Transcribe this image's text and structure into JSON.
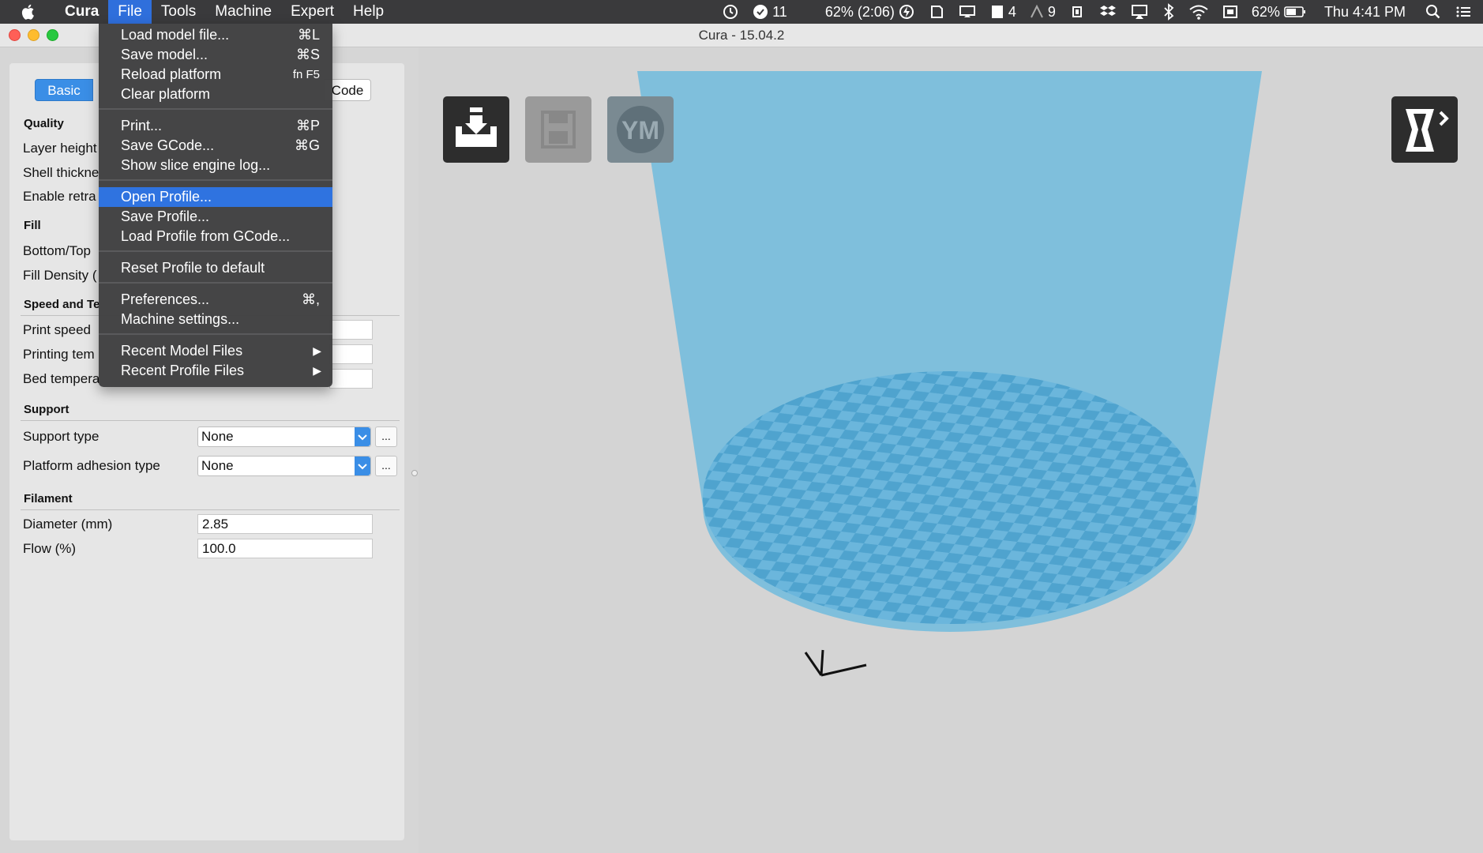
{
  "menubar": {
    "app_name": "Cura",
    "items": [
      "File",
      "Tools",
      "Machine",
      "Expert",
      "Help"
    ],
    "active_item": "File"
  },
  "status": {
    "notification_count": "11",
    "battery_estimate": "62% (2:06)",
    "badge_a": "4",
    "badge_b": "9",
    "battery_percent": "62%",
    "clock": "Thu 4:41 PM"
  },
  "window": {
    "title": "Cura - 15.04.2",
    "traffic_lights": {
      "close": "#ff5f57",
      "minimize": "#febc2e",
      "zoom": "#28c840"
    }
  },
  "panel": {
    "tabs": {
      "basic": "Basic",
      "gcode_partial": "Code"
    },
    "sections": {
      "quality": "Quality",
      "fill": "Fill",
      "speed": "Speed and Te",
      "support": "Support",
      "filament": "Filament"
    },
    "labels": {
      "layer_height": "Layer height",
      "shell_thickness": "Shell thickne",
      "enable_retraction": "Enable retra",
      "bottom_top": "Bottom/Top",
      "fill_density": "Fill Density (",
      "print_speed": "Print speed",
      "printing_temp": "Printing tem",
      "bed_temp": "Bed tempera",
      "support_type": "Support type",
      "platform_adhesion": "Platform adhesion type",
      "diameter": "Diameter (mm)",
      "flow": "Flow (%)"
    },
    "values": {
      "support_type": "None",
      "platform_adhesion": "None",
      "diameter": "2.85",
      "flow": "100.0",
      "ellipsis": "..."
    }
  },
  "file_menu": {
    "load_model": {
      "label": "Load model file...",
      "shortcut": "⌘L"
    },
    "save_model": {
      "label": "Save model...",
      "shortcut": "⌘S"
    },
    "reload_platform": {
      "label": "Reload platform",
      "shortcut": "fn F5"
    },
    "clear_platform": {
      "label": "Clear platform"
    },
    "print": {
      "label": "Print...",
      "shortcut": "⌘P"
    },
    "save_gcode": {
      "label": "Save GCode...",
      "shortcut": "⌘G"
    },
    "show_log": {
      "label": "Show slice engine log..."
    },
    "open_profile": {
      "label": "Open Profile..."
    },
    "save_profile": {
      "label": "Save Profile..."
    },
    "load_profile_gcode": {
      "label": "Load Profile from GCode..."
    },
    "reset_profile": {
      "label": "Reset Profile to default"
    },
    "preferences": {
      "label": "Preferences...",
      "shortcut": "⌘,"
    },
    "machine_settings": {
      "label": "Machine settings..."
    },
    "recent_models": {
      "label": "Recent Model Files"
    },
    "recent_profiles": {
      "label": "Recent Profile Files"
    },
    "submenu_arrow": "▶"
  },
  "viewport": {
    "tools": {
      "load": "load-model-icon",
      "save": "save-toolpath-icon",
      "youmagine": "YM",
      "view": "view-mode-icon"
    },
    "colors": {
      "build_volume": "#7fbfdc",
      "platform_dark": "#4fa3ce",
      "platform_light": "#6bb6dc",
      "background": "#d4d4d4"
    }
  }
}
